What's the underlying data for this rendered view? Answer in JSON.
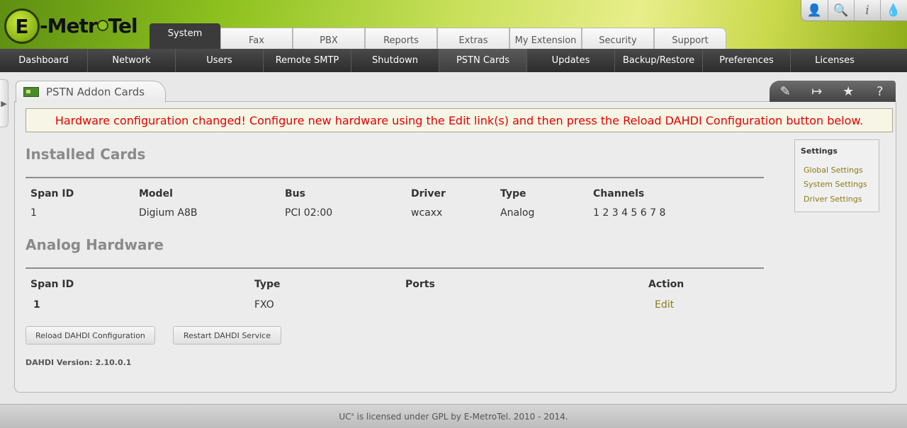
{
  "logo": {
    "letter": "E",
    "text_before": "-Metr",
    "text_after": "Tel"
  },
  "top_icons": [
    "user-icon",
    "search-icon",
    "info-icon",
    "drop-icon"
  ],
  "top_icon_glyphs": [
    "👤",
    "🔍",
    "i",
    "💧"
  ],
  "main_tabs": [
    "System",
    "Fax",
    "PBX",
    "Reports",
    "Extras",
    "My Extension",
    "Security",
    "Support"
  ],
  "active_main_tab": "System",
  "sub_nav": [
    "Dashboard",
    "Network",
    "Users",
    "Remote SMTP",
    "Shutdown",
    "PSTN Cards",
    "Updates",
    "Backup/Restore",
    "Preferences",
    "Licenses"
  ],
  "active_sub_nav": "PSTN Cards",
  "panel": {
    "title": "PSTN Addon Cards",
    "actions": [
      "edit-icon",
      "export-icon",
      "star-icon",
      "help-icon"
    ],
    "action_glyphs": [
      "✎",
      "↦",
      "★",
      "?"
    ]
  },
  "alert": "Hardware configuration changed! Configure new hardware using the Edit link(s) and then press the Reload DAHDI Configuration button below.",
  "installed_cards": {
    "title": "Installed Cards",
    "headers": [
      "Span ID",
      "Model",
      "Bus",
      "Driver",
      "Type",
      "Channels"
    ],
    "rows": [
      [
        "1",
        "Digium A8B",
        "PCI 02:00",
        "wcaxx",
        "Analog",
        "1 2 3 4 5 6 7 8"
      ]
    ]
  },
  "analog_hardware": {
    "title": "Analog Hardware",
    "headers": [
      "Span ID",
      "Type",
      "Ports",
      "Action"
    ],
    "rows": [
      [
        "1",
        "FXO",
        "",
        "Edit"
      ]
    ]
  },
  "buttons": {
    "reload": "Reload DAHDI Configuration",
    "restart": "Restart DAHDI Service"
  },
  "version": "DAHDI Version: 2.10.0.1",
  "settings": {
    "title": "Settings",
    "links": [
      "Global Settings",
      "System Settings",
      "Driver Settings"
    ]
  },
  "footer": {
    "uc": "UC",
    "sup": "x",
    "rest": " is licensed under GPL by E-MetroTel. 2010 - 2014."
  }
}
